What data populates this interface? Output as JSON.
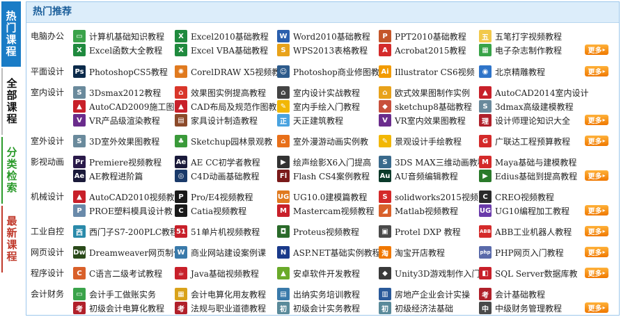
{
  "tabs": [
    "热门课程",
    "全部课程",
    "分类检索",
    "最新课程"
  ],
  "header": {
    "title": "热门推荐"
  },
  "more_label": "更多",
  "rows": [
    {
      "category": "电脑办公",
      "lines": [
        [
          {
            "label": "计算机基础知识教程",
            "icon": "monitor-icon",
            "color": "#3aa34a",
            "glyph": "▭"
          },
          {
            "label": "Excel2010基础教程",
            "icon": "excel-icon",
            "color": "#1f8a3e",
            "glyph": "X"
          },
          {
            "label": "Word2010基础教程",
            "icon": "word-icon",
            "color": "#2b5fad",
            "glyph": "W"
          },
          {
            "label": "PPT2010基础教程",
            "icon": "ppt-icon",
            "color": "#c4562a",
            "glyph": "P"
          },
          {
            "label": "五笔打字视频教程",
            "icon": "wubi-icon",
            "color": "#f2c94c",
            "glyph": "五"
          }
        ],
        [
          {
            "label": "Excel函数大全教程",
            "icon": "excel-icon",
            "color": "#1f8a3e",
            "glyph": "X"
          },
          {
            "label": "Excel VBA基础教程",
            "icon": "excel-icon",
            "color": "#1f8a3e",
            "glyph": "X"
          },
          {
            "label": "WPS2013表格教程",
            "icon": "wps-icon",
            "color": "#e8a21a",
            "glyph": "S"
          },
          {
            "label": "Acrobat2015教程",
            "icon": "acrobat-icon",
            "color": "#d42a2a",
            "glyph": "A"
          },
          {
            "label": "电子杂志制作教程",
            "icon": "magazine-icon",
            "color": "#38a348",
            "glyph": "▦"
          }
        ]
      ]
    },
    {
      "category": "平面设计",
      "lines": [
        [
          {
            "label": "PhotoshopCS5教程",
            "icon": "photoshop-icon",
            "color": "#0b2a4a",
            "glyph": "Ps"
          },
          {
            "label": "CorelDRAW X5视频教",
            "icon": "coreldraw-icon",
            "color": "#e07a1f",
            "glyph": "✺"
          },
          {
            "label": "Photoshop商业修图教",
            "icon": "person-icon",
            "color": "#2d5b8c",
            "glyph": "☺"
          },
          {
            "label": "Illustrator CS6视频",
            "icon": "illustrator-icon",
            "color": "#f29b00",
            "glyph": "Ai"
          },
          {
            "label": "北京精雕教程",
            "icon": "globe-icon",
            "color": "#2e74c9",
            "glyph": "◉"
          }
        ]
      ]
    },
    {
      "category": "室内设计",
      "lines": [
        [
          {
            "label": "3Dsmax2012教程",
            "icon": "3dsmax-icon",
            "color": "#6a8a9c",
            "glyph": "S"
          },
          {
            "label": "效果图实例提高教程",
            "icon": "house-icon",
            "color": "#d9362a",
            "glyph": "⌂"
          },
          {
            "label": "室内设计实战教程",
            "icon": "house-icon",
            "color": "#444444",
            "glyph": "⌂"
          },
          {
            "label": "欧式效果图制作实例",
            "icon": "house-icon",
            "color": "#e8a21a",
            "glyph": "⌂"
          },
          {
            "label": "AutoCAD2014室内设计",
            "icon": "autocad-icon",
            "color": "#c8202a",
            "glyph": "▲"
          }
        ],
        [
          {
            "label": "AutoCAD2009施工图教",
            "icon": "autocad-icon",
            "color": "#c8202a",
            "glyph": "▲"
          },
          {
            "label": "CAD布局及规范作图教",
            "icon": "autocad-icon",
            "color": "#c8202a",
            "glyph": "▲"
          },
          {
            "label": "室内手绘入门教程",
            "icon": "pencil-icon",
            "color": "#f2b705",
            "glyph": "✎"
          },
          {
            "label": "sketchup8基础教程",
            "icon": "sketchup-icon",
            "color": "#c8503c",
            "glyph": "◆"
          },
          {
            "label": "3dmax高级建模教程",
            "icon": "3dsmax-icon",
            "color": "#6a8a9c",
            "glyph": "S"
          }
        ],
        [
          {
            "label": "VR产品级渲染教程",
            "icon": "vray-icon",
            "color": "#6a2c8c",
            "glyph": "V"
          },
          {
            "label": "家具设计制造教程",
            "icon": "furniture-icon",
            "color": "#8c4a2a",
            "glyph": "▤"
          },
          {
            "label": "天正建筑教程",
            "icon": "tangent-icon",
            "color": "#4aa3df",
            "glyph": "正"
          },
          {
            "label": "VR室内效果图教程",
            "icon": "vray-icon",
            "color": "#6a2c8c",
            "glyph": "V"
          },
          {
            "label": "设计师理论知识大全",
            "icon": "theory-icon",
            "color": "#b0202a",
            "glyph": "理"
          }
        ]
      ]
    },
    {
      "category": "室外设计",
      "lines": [
        [
          {
            "label": "3D室外效果图教程",
            "icon": "3dsmax-icon",
            "color": "#6a8a9c",
            "glyph": "S"
          },
          {
            "label": "Sketchup园林景观教",
            "icon": "tree-icon",
            "color": "#3a9a3a",
            "glyph": "♣"
          },
          {
            "label": "室外漫游动画实例教",
            "icon": "house-icon",
            "color": "#e8701a",
            "glyph": "⌂"
          },
          {
            "label": "景观设计手绘教程",
            "icon": "pencil-icon",
            "color": "#f2b705",
            "glyph": "✎"
          },
          {
            "label": "广联达工程预算教程",
            "icon": "glodon-icon",
            "color": "#d42a2a",
            "glyph": "G"
          }
        ]
      ]
    },
    {
      "category": "影视动画",
      "lines": [
        [
          {
            "label": "Premiere视频教程",
            "icon": "premiere-icon",
            "color": "#2a1a4a",
            "glyph": "Pr"
          },
          {
            "label": "AE CC初学者教程",
            "icon": "aftereffects-icon",
            "color": "#1a1a3a",
            "glyph": "Ae"
          },
          {
            "label": "绘声绘影X6入门提高",
            "icon": "film-icon",
            "color": "#333333",
            "glyph": "▶"
          },
          {
            "label": "3DS MAX三维动画教程",
            "icon": "3dsmax-icon",
            "color": "#3a6a8c",
            "glyph": "S"
          },
          {
            "label": "Maya基础与建模教程",
            "icon": "maya-icon",
            "color": "#d42a2a",
            "glyph": "M"
          }
        ],
        [
          {
            "label": "AE教程进阶篇",
            "icon": "aftereffects-icon",
            "color": "#1a1a3a",
            "glyph": "Ae"
          },
          {
            "label": "C4D动画基础教程",
            "icon": "c4d-icon",
            "color": "#1a3a6a",
            "glyph": "◎"
          },
          {
            "label": "Flash CS4案例教程",
            "icon": "flash-icon",
            "color": "#7a1a1a",
            "glyph": "Fl"
          },
          {
            "label": "AU音频编辑教程",
            "icon": "audition-icon",
            "color": "#0a3a2a",
            "glyph": "Au"
          },
          {
            "label": "Edius基础到提高教程",
            "icon": "edius-icon",
            "color": "#2a7a2a",
            "glyph": "▶"
          }
        ]
      ]
    },
    {
      "category": "机械设计",
      "lines": [
        [
          {
            "label": "AutoCAD2010视频教程",
            "icon": "autocad-icon",
            "color": "#c8202a",
            "glyph": "▲"
          },
          {
            "label": "Pro/E4视频教程",
            "icon": "proe-icon",
            "color": "#1a1a1a",
            "glyph": "P"
          },
          {
            "label": "UG10.0建模篇教程",
            "icon": "ug-icon",
            "color": "#e07a1f",
            "glyph": "UG"
          },
          {
            "label": "solidworks2015视频",
            "icon": "solidworks-icon",
            "color": "#d42a2a",
            "glyph": "S"
          },
          {
            "label": "CREO视频教程",
            "icon": "creo-icon",
            "color": "#2a2a2a",
            "glyph": "C"
          }
        ],
        [
          {
            "label": "PROE塑料模具设计教",
            "icon": "proe-icon",
            "color": "#6a8aaa",
            "glyph": "P"
          },
          {
            "label": "Catia视频教程",
            "icon": "catia-icon",
            "color": "#1a1a1a",
            "glyph": "C"
          },
          {
            "label": "Mastercam视频教程",
            "icon": "mastercam-icon",
            "color": "#c8202a",
            "glyph": "M"
          },
          {
            "label": "Matlab视频教程",
            "icon": "matlab-icon",
            "color": "#d9602a",
            "glyph": "◢"
          },
          {
            "label": "UG10编程加工教程",
            "icon": "ug-icon",
            "color": "#6a3aaa",
            "glyph": "UG"
          }
        ]
      ]
    },
    {
      "category": "工业自控",
      "lines": [
        [
          {
            "label": "西门子S7-200PLC教程",
            "icon": "siemens-icon",
            "color": "#2a8aaa",
            "glyph": "西"
          },
          {
            "label": "51单片机视频教程",
            "icon": "chip-icon",
            "color": "#c8202a",
            "glyph": "51"
          },
          {
            "label": "Proteus视频教程",
            "icon": "proteus-icon",
            "color": "#2a6a2a",
            "glyph": "◘"
          },
          {
            "label": "Protel DXP 教程",
            "icon": "protel-icon",
            "color": "#4a4a4a",
            "glyph": "▣"
          },
          {
            "label": "ABB工业机器人教程",
            "icon": "abb-icon",
            "color": "#d42a2a",
            "glyph": "ABB"
          }
        ]
      ]
    },
    {
      "category": "网页设计",
      "lines": [
        [
          {
            "label": "Dreamweaver网页制作",
            "icon": "dreamweaver-icon",
            "color": "#2a4a1a",
            "glyph": "Dw"
          },
          {
            "label": "商业网站建设案例课",
            "icon": "website-icon",
            "color": "#3a7aaa",
            "glyph": "W"
          },
          {
            "label": "ASP.NET基础实例教程",
            "icon": "aspnet-icon",
            "color": "#1a3a8a",
            "glyph": "N"
          },
          {
            "label": "淘宝开店教程",
            "icon": "taobao-icon",
            "color": "#f07800",
            "glyph": "淘"
          },
          {
            "label": "PHP网页入门教程",
            "icon": "php-icon",
            "color": "#5a6aaa",
            "glyph": "php"
          }
        ]
      ]
    },
    {
      "category": "程序设计",
      "lines": [
        [
          {
            "label": "C语言二级考试教程",
            "icon": "c-language-icon",
            "color": "#d9602a",
            "glyph": "C"
          },
          {
            "label": "Java基础视频教程",
            "icon": "java-icon",
            "color": "#c8202a",
            "glyph": "☕"
          },
          {
            "label": "安卓软件开发教程",
            "icon": "android-icon",
            "color": "#6aaa2a",
            "glyph": "▲"
          },
          {
            "label": "Unity3D游戏制作入门",
            "icon": "unity-icon",
            "color": "#3a3a3a",
            "glyph": "◆"
          },
          {
            "label": "SQL Server数据库教",
            "icon": "sqlserver-icon",
            "color": "#c8202a",
            "glyph": "◧"
          }
        ]
      ]
    },
    {
      "category": "会计财务",
      "lines": [
        [
          {
            "label": "会计手工做账实务",
            "icon": "ledger-icon",
            "color": "#3aa34a",
            "glyph": "▭"
          },
          {
            "label": "会计电算化用友教程",
            "icon": "calculator-icon",
            "color": "#d9a21a",
            "glyph": "▦"
          },
          {
            "label": "出纳实务培训教程",
            "icon": "cashier-icon",
            "color": "#3a7aaa",
            "glyph": "▤"
          },
          {
            "label": "房地产企业会计实操",
            "icon": "building-icon",
            "color": "#2a5a9a",
            "glyph": "▥"
          },
          {
            "label": "会计基础教程",
            "icon": "exam-icon",
            "color": "#b0202a",
            "glyph": "考"
          }
        ],
        [
          {
            "label": "初级会计电算化教程",
            "icon": "exam-icon",
            "color": "#b0202a",
            "glyph": "考"
          },
          {
            "label": "法规与职业道德教程",
            "icon": "exam-icon",
            "color": "#b0202a",
            "glyph": "考"
          },
          {
            "label": "初级会计实务教程",
            "icon": "junior-icon",
            "color": "#5a8a9a",
            "glyph": "初"
          },
          {
            "label": "初级经济法基础",
            "icon": "junior-icon",
            "color": "#5a8a9a",
            "glyph": "初"
          },
          {
            "label": "中级财务管理教程",
            "icon": "intermediate-icon",
            "color": "#4a4a4a",
            "glyph": "中"
          }
        ]
      ]
    }
  ]
}
